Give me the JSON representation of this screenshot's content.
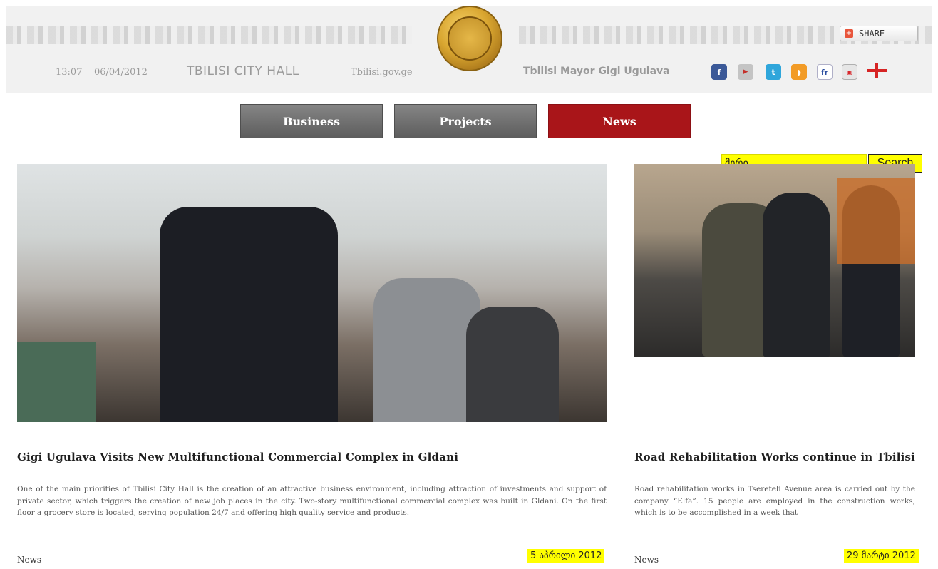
{
  "header": {
    "time": "13:07",
    "date": "06/04/2012",
    "site_title": "TBILISI CITY HALL",
    "domain": "Tbilisi.gov.ge",
    "mayor_link": "Tbilisi Mayor Gigi Ugulava",
    "share_label": "SHARE",
    "social_icons": [
      "facebook-icon",
      "youtube-icon",
      "twitter-icon",
      "rss-icon",
      "friendfeed-icon",
      "myvideo-icon",
      "georgian-flag-icon"
    ]
  },
  "nav": {
    "items": [
      {
        "label": "Business",
        "active": false
      },
      {
        "label": "Projects",
        "active": false
      },
      {
        "label": "News",
        "active": true
      }
    ],
    "active_color": "#a91519"
  },
  "search": {
    "value": "მერი",
    "button_label": "Search",
    "highlight_color": "#ffff00"
  },
  "articles": [
    {
      "title": "Gigi Ugulava Visits New Multifunctional Commercial Complex in Gldani",
      "body": "One of the main priorities of Tbilisi City Hall is the creation of an attractive business environment, including attraction of investments and support of private sector, which triggers the creation of new job places in the city. Two-story multifunctional commercial complex was built in Gldani. On the first floor a grocery store is located, serving population 24/7 and offering high quality service and products.",
      "category": "News",
      "date": "5 აპრილი 2012"
    },
    {
      "title": "Road Rehabilitation Works continue in Tbilisi",
      "body": "Road rehabilitation works in Tsereteli Avenue area is carried out by the company “Elfa”. 15 people are employed in the construction works, which is to be accomplished in a week that",
      "category": "News",
      "date": "29 მარტი 2012"
    }
  ]
}
